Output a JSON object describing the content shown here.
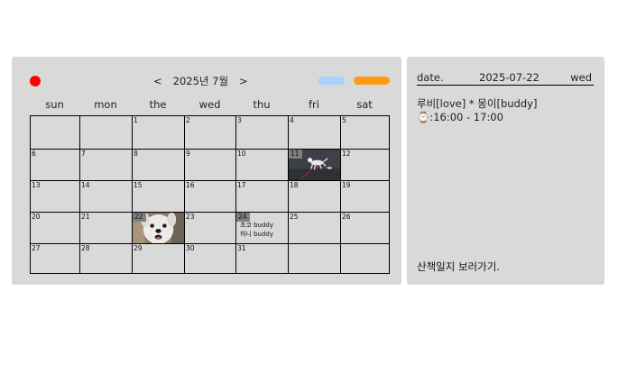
{
  "calendar": {
    "nav": {
      "prev": "<",
      "next": ">",
      "month_label": "2025년 7월"
    },
    "colors": {
      "record_dot": "#ff0000",
      "legend_blue": "#a9d1fb",
      "legend_orange": "#ff9b12"
    },
    "weekdays": [
      "sun",
      "mon",
      "the",
      "wed",
      "thu",
      "fri",
      "sat"
    ],
    "weeks": [
      [
        "",
        "",
        "1",
        "2",
        "3",
        "4",
        "5"
      ],
      [
        "6",
        "7",
        "8",
        "9",
        "10",
        "11",
        "12"
      ],
      [
        "13",
        "14",
        "15",
        "16",
        "17",
        "18",
        "19"
      ],
      [
        "20",
        "21",
        "22",
        "23",
        "24",
        "25",
        "26"
      ],
      [
        "27",
        "28",
        "29",
        "30",
        "31",
        "",
        ""
      ]
    ],
    "photo_days": [
      {
        "day": "11",
        "photo": "dog-walking-photo"
      },
      {
        "day": "22",
        "photo": "dog-face-photo"
      }
    ],
    "event_days": [
      {
        "day": "24",
        "lines": [
          "초코 buddy",
          "허니 buddy"
        ]
      }
    ]
  },
  "detail": {
    "date_label": "date.",
    "date_value": "2025-07-22",
    "day_value": "wed",
    "entry_names": "루비[love] * 몽이[buddy]",
    "time_icon": "⌚",
    "time_range": ":16:00 - 17:00",
    "journal_link": "산책일지 보러가기."
  }
}
